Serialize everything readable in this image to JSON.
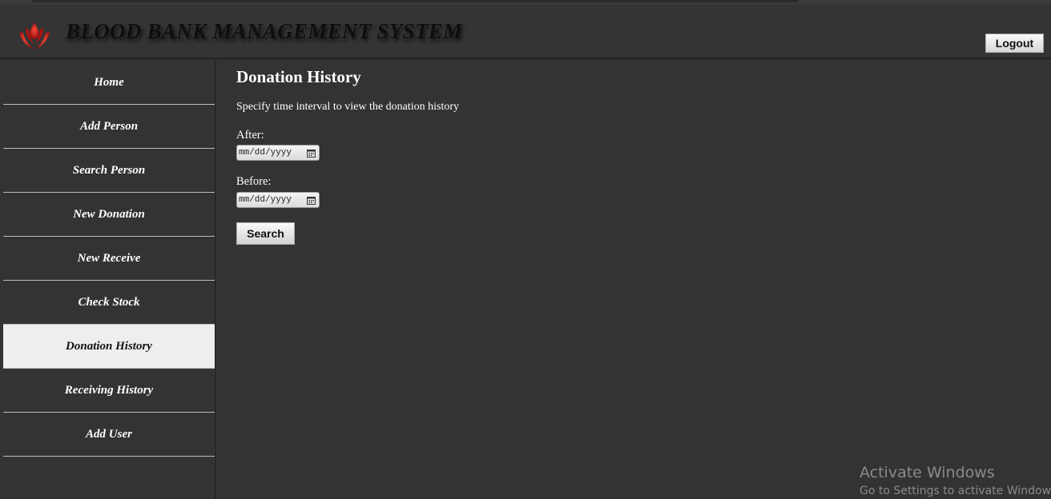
{
  "header": {
    "title": "BLOOD BANK MANAGEMENT SYSTEM",
    "logout_label": "Logout",
    "logo_icon": "blood-drop-hands-icon",
    "logo_color": "#c81414"
  },
  "sidebar": {
    "items": [
      {
        "label": "Home",
        "active": false
      },
      {
        "label": "Add Person",
        "active": false
      },
      {
        "label": "Search Person",
        "active": false
      },
      {
        "label": "New Donation",
        "active": false
      },
      {
        "label": "New Receive",
        "active": false
      },
      {
        "label": "Check Stock",
        "active": false
      },
      {
        "label": "Donation History",
        "active": true
      },
      {
        "label": "Receiving History",
        "active": false
      },
      {
        "label": "Add User",
        "active": false
      }
    ]
  },
  "main": {
    "title": "Donation History",
    "instructions": "Specify time interval to view the donation history",
    "after_label": "After:",
    "after_value": "mm/dd/yyyy",
    "before_label": "Before:",
    "before_value": "mm/dd/yyyy",
    "search_label": "Search"
  },
  "watermark": {
    "title": "Activate Windows",
    "subtitle": "Go to Settings to activate Windows."
  },
  "colors": {
    "background": "#333333",
    "active_item": "#eeeeee",
    "text": "#ffffff"
  }
}
